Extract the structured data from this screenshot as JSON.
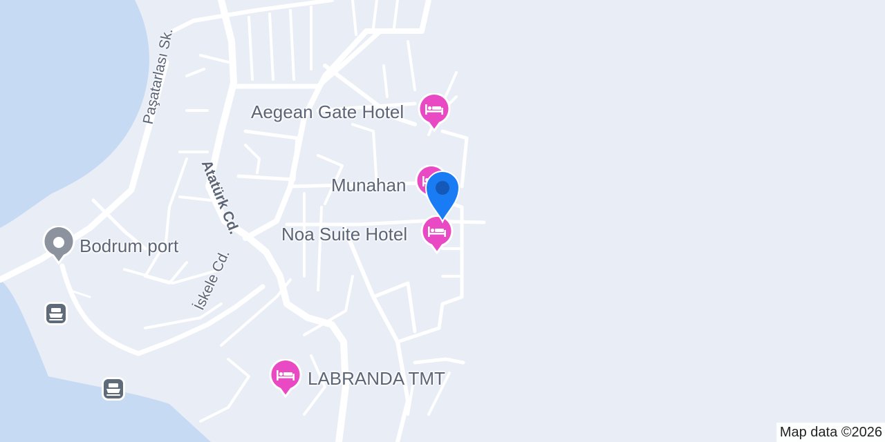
{
  "map": {
    "pois": {
      "aegean_gate": {
        "label": "Aegean Gate Hotel",
        "category": "hotel"
      },
      "munahan": {
        "label": "Munahan",
        "category": "hotel"
      },
      "noa_suite": {
        "label": "Noa Suite Hotel",
        "category": "hotel"
      },
      "labranda": {
        "label": "LABRANDA TMT",
        "category": "hotel"
      },
      "bodrum_port": {
        "label": "Bodrum port",
        "category": "place"
      }
    },
    "streets": {
      "pasatarlasi": "Paşatarlası Sk.",
      "ataturk": "Atatürk Cd.",
      "iskele": "İskele Cd."
    },
    "icons": {
      "hotel": "hotel-bed-icon",
      "place": "place-pin-icon",
      "ferry": "ferry-icon",
      "location": "location-marker-icon"
    },
    "colors": {
      "land": "#e8edf6",
      "water": "#c6daf3",
      "road": "#ffffff",
      "hotel_pin": "#e94ac3",
      "location_marker": "#1a7cf4",
      "place_pin": "#8c939e",
      "ferry_badge": "#5f6b78",
      "label_text": "#5b6577"
    },
    "attribution": "Map data ©2026"
  }
}
